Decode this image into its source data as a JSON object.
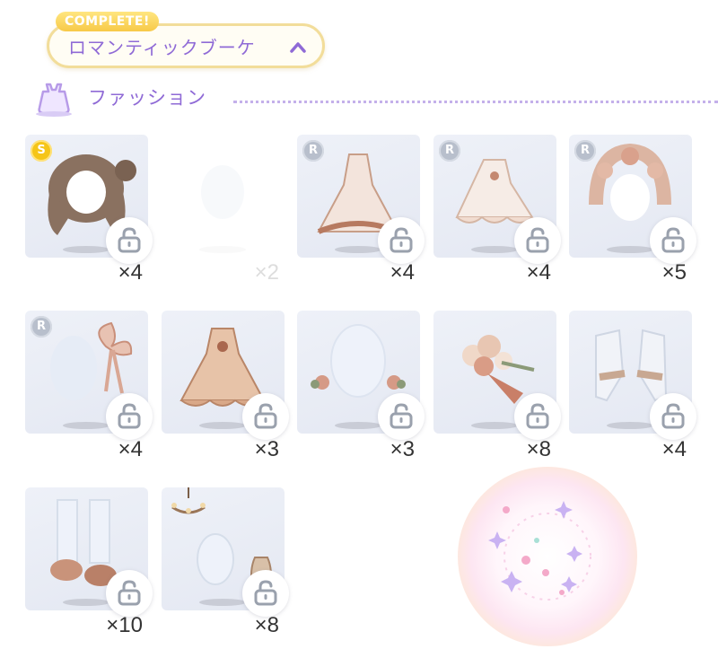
{
  "set_header": {
    "badge": "COMPLETE!",
    "title": "ロマンティックブーケ"
  },
  "section": {
    "title": "ファッション"
  },
  "colors": {
    "accent_purple": "#8f6ad6",
    "badge_gold": "#f7c948",
    "card_bg": "#eef1f8"
  },
  "items": [
    {
      "rarity": "S",
      "qty": "×4",
      "icon": "hair-icon"
    },
    {
      "rarity": "",
      "qty": "×2",
      "icon": "faded-item-icon"
    },
    {
      "rarity": "R",
      "qty": "×4",
      "icon": "dress-icon"
    },
    {
      "rarity": "R",
      "qty": "×4",
      "icon": "frilled-dress-icon"
    },
    {
      "rarity": "R",
      "qty": "×5",
      "icon": "rose-headpiece-icon"
    },
    {
      "rarity": "R",
      "qty": "×4",
      "icon": "bow-icon"
    },
    {
      "rarity": "",
      "qty": "×3",
      "icon": "ruffled-dress-icon"
    },
    {
      "rarity": "",
      "qty": "×3",
      "icon": "rose-accessory-icon"
    },
    {
      "rarity": "",
      "qty": "×8",
      "icon": "bouquet-icon"
    },
    {
      "rarity": "",
      "qty": "×4",
      "icon": "gloves-icon"
    },
    {
      "rarity": "",
      "qty": "×10",
      "icon": "shoes-icon"
    },
    {
      "rarity": "",
      "qty": "×8",
      "icon": "chandelier-room-icon"
    }
  ]
}
